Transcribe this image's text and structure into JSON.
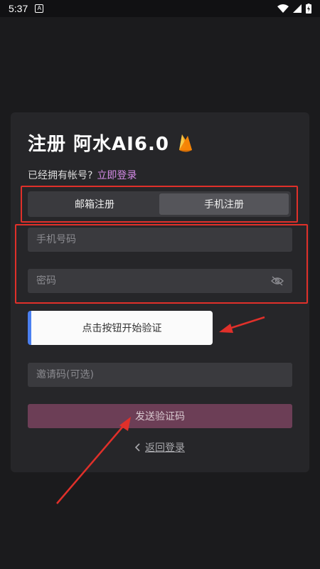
{
  "status_bar": {
    "time": "5:37",
    "notification_icon": "a-icon"
  },
  "title": {
    "text": "注册 阿水AI6.0",
    "logo_icon": "flame-icon"
  },
  "login_prompt": {
    "text": "已经拥有帐号?",
    "link": "立即登录"
  },
  "tabs": [
    {
      "label": "邮箱注册",
      "active": false
    },
    {
      "label": "手机注册",
      "active": true
    }
  ],
  "phone_field": {
    "placeholder": "手机号码"
  },
  "password_field": {
    "placeholder": "密码"
  },
  "verify_button": {
    "label": "点击按钮开始验证"
  },
  "invite_field": {
    "placeholder": "邀请码(可选)"
  },
  "send_button": {
    "label": "发送验证码"
  },
  "back_link": {
    "label": "返回登录"
  },
  "colors": {
    "accent_link": "#d68be8",
    "send_button": "#6c3e56",
    "annotation": "#e0302a",
    "verify_bar": "#4a7ff0"
  }
}
